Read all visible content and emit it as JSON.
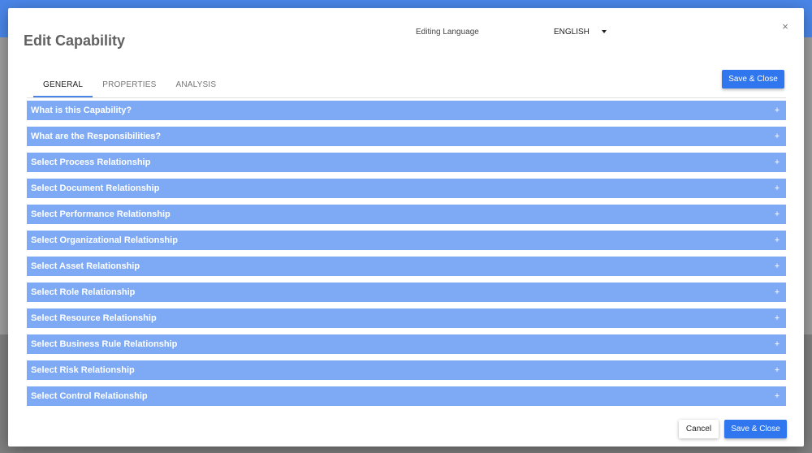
{
  "dialog": {
    "title": "Edit Capability",
    "close_icon": "×"
  },
  "language": {
    "label": "Editing Language",
    "value": "ENGLISH"
  },
  "tabs": [
    {
      "label": "GENERAL",
      "active": true
    },
    {
      "label": "PROPERTIES",
      "active": false
    },
    {
      "label": "ANALYSIS",
      "active": false
    }
  ],
  "buttons": {
    "save_close_top": "Save & Close",
    "cancel": "Cancel",
    "save_close_bottom": "Save & Close"
  },
  "sections": [
    {
      "title": "What is this Capability?",
      "icon": "+"
    },
    {
      "title": "What are the Responsibilities?",
      "icon": "+"
    },
    {
      "title": "Select Process Relationship",
      "icon": "+"
    },
    {
      "title": "Select Document Relationship",
      "icon": "+"
    },
    {
      "title": "Select Performance Relationship",
      "icon": "+"
    },
    {
      "title": "Select Organizational Relationship",
      "icon": "+"
    },
    {
      "title": "Select Asset Relationship",
      "icon": "+"
    },
    {
      "title": "Select Role Relationship",
      "icon": "+"
    },
    {
      "title": "Select Resource Relationship",
      "icon": "+"
    },
    {
      "title": "Select Business Rule Relationship",
      "icon": "+"
    },
    {
      "title": "Select Risk Relationship",
      "icon": "+"
    },
    {
      "title": "Select Control Relationship",
      "icon": "+"
    }
  ],
  "colors": {
    "accent": "#2f76ef",
    "section_bar": "#7eaaf5",
    "header_bar": "#4a86e8"
  },
  "icons": {
    "close": "close-icon",
    "dropdown": "caret-down-icon",
    "expand": "plus-icon"
  }
}
